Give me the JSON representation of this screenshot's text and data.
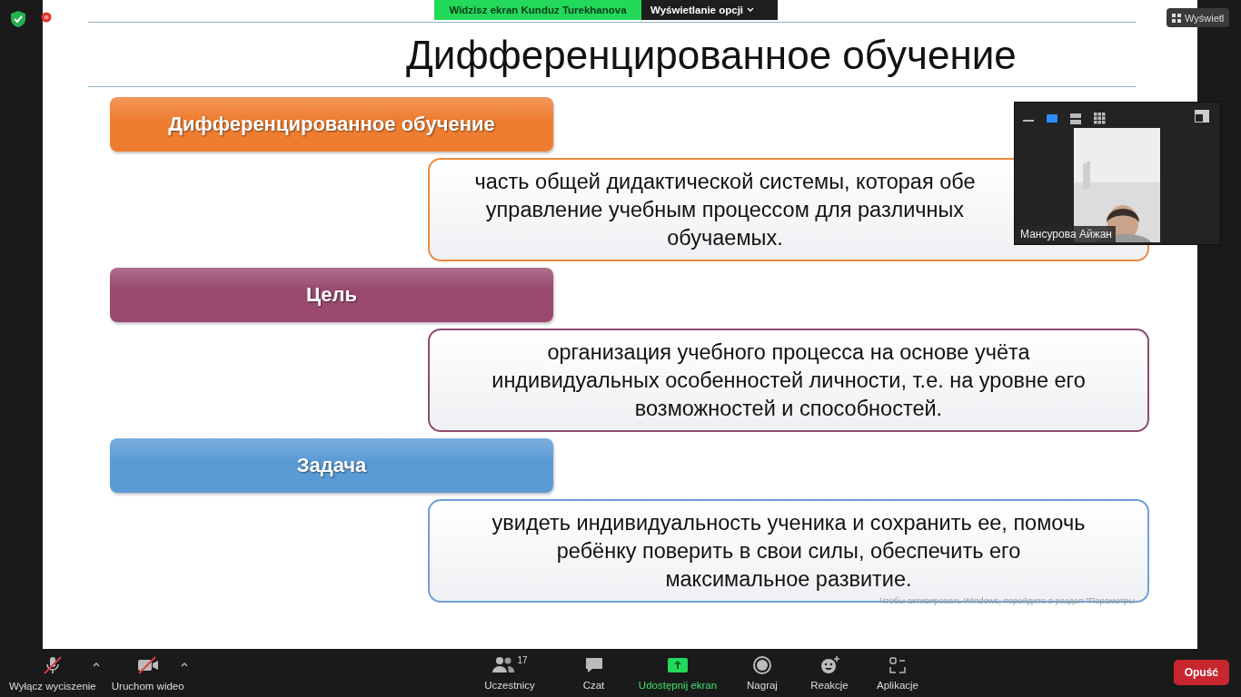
{
  "banner": {
    "sharing": "Widzisz ekran Kunduz Turekhanova",
    "view_options": "Wyświetlanie opcji"
  },
  "view_button": "Wyświetl",
  "slide": {
    "title": "Дифференцированное обучение",
    "blocks": [
      {
        "kind": "heading",
        "color": "#ee7d31",
        "text": "Дифференцированное обучение"
      },
      {
        "kind": "text",
        "color": "#ee8a3e",
        "lines": [
          "часть общей дидактической системы, которая обе",
          "управление учебным процессом для различных",
          "обучаемых."
        ]
      },
      {
        "kind": "heading",
        "color": "#9a4a70",
        "text": "Цель"
      },
      {
        "kind": "text",
        "color": "#8e4a6e",
        "lines": [
          "организация учебного процесса на основе учёта",
          "индивидуальных особенностей личности, т.е. на уровне его",
          "возможностей и способностей."
        ]
      },
      {
        "kind": "heading",
        "color": "#5b9bd5",
        "text": "Задача"
      },
      {
        "kind": "text",
        "color": "#6fa0d8",
        "lines": [
          "увидеть индивидуальность ученика и сохранить ее, помочь",
          "ребёнку поверить в свои силы, обеспечить его",
          "максимальное развитие."
        ]
      }
    ]
  },
  "windows_notice": "Чтобы активировать Windows, перейдите в раздел \"Параметры",
  "video": {
    "name": "Мансурова Айжан",
    "layouts": [
      {
        "kind": "minimize",
        "selected": false
      },
      {
        "kind": "speaker",
        "selected": true
      },
      {
        "kind": "strip",
        "selected": false
      },
      {
        "kind": "gallery",
        "selected": false
      }
    ]
  },
  "toolbar": {
    "left": [
      {
        "kind": "mic",
        "label": "Wyłącz wyciszenie",
        "off": true
      },
      {
        "kind": "video",
        "label": "Uruchom wideo",
        "off": true
      }
    ],
    "center": [
      {
        "kind": "participants",
        "label": "Uczestnicy",
        "count": "17"
      },
      {
        "kind": "chat",
        "label": "Czat"
      },
      {
        "kind": "share",
        "label": "Udostępnij ekran"
      },
      {
        "kind": "record",
        "label": "Nagraj"
      },
      {
        "kind": "reactions",
        "label": "Reakcje"
      },
      {
        "kind": "apps",
        "label": "Aplikacje"
      }
    ],
    "leave": "Opuść"
  }
}
